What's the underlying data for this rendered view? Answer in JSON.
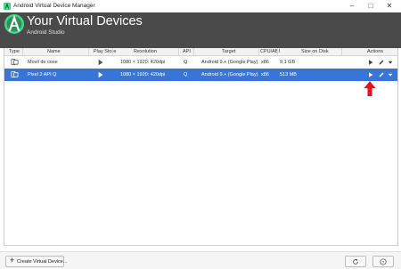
{
  "window": {
    "title": "Android Virtual Device Manager"
  },
  "header": {
    "title": "Your Virtual Devices",
    "subtitle": "Android Studio"
  },
  "table": {
    "columns": [
      "Type",
      "Name",
      "Play Store",
      "Resolution",
      "API",
      "Target",
      "CPU/ABI",
      "Size on Disk",
      "Actions"
    ],
    "rows": [
      {
        "name": "Movil de cose",
        "resolution": "1080 × 1920: 420dpi",
        "api": "Q",
        "target": "Android 9.+ (Google Play)",
        "cpu": "x86",
        "size": "9,1 GB",
        "selected": false
      },
      {
        "name": "Pixel 2 API Q",
        "resolution": "1080 × 1920: 420dpi",
        "api": "Q",
        "target": "Android 9.+ (Google Play)",
        "cpu": "x86",
        "size": "513 MB",
        "selected": true
      }
    ]
  },
  "footer": {
    "create_label": "Create Virtual Device..."
  },
  "colors": {
    "header_bg": "#4a4a4a",
    "selection": "#3875d6",
    "android_green": "#3ddc84",
    "annotation": "#e0151b"
  },
  "icons": [
    "device-icon",
    "play-store-icon",
    "launch-icon",
    "edit-icon",
    "menu-arrow-icon",
    "refresh-icon",
    "help-icon"
  ]
}
